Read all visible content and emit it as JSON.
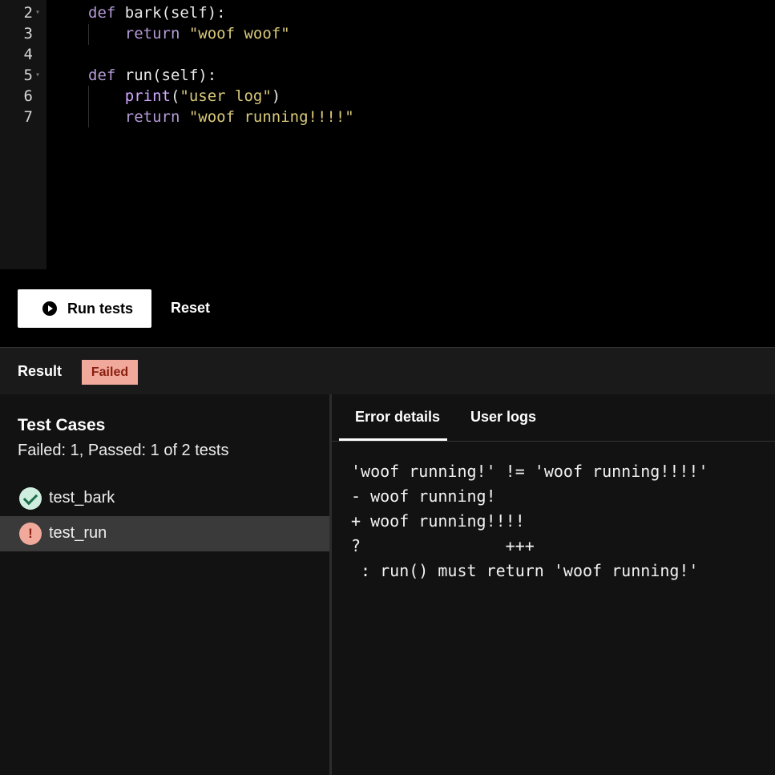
{
  "editor": {
    "lines": [
      {
        "num": "2",
        "fold": true,
        "parts": [
          {
            "t": "def ",
            "c": "kw"
          },
          {
            "t": "bark",
            "c": "plain"
          },
          {
            "t": "(self):",
            "c": "plain"
          }
        ]
      },
      {
        "num": "3",
        "fold": false,
        "parts": [
          {
            "t": "    return ",
            "c": "kw"
          },
          {
            "t": "\"woof woof\"",
            "c": "str"
          }
        ]
      },
      {
        "num": "4",
        "fold": false,
        "parts": []
      },
      {
        "num": "5",
        "fold": true,
        "parts": [
          {
            "t": "def ",
            "c": "kw"
          },
          {
            "t": "run",
            "c": "plain"
          },
          {
            "t": "(self):",
            "c": "plain"
          }
        ]
      },
      {
        "num": "6",
        "fold": false,
        "parts": [
          {
            "t": "    print",
            "c": "fn"
          },
          {
            "t": "(",
            "c": "plain"
          },
          {
            "t": "\"user log\"",
            "c": "str"
          },
          {
            "t": ")",
            "c": "plain"
          }
        ]
      },
      {
        "num": "7",
        "fold": false,
        "parts": [
          {
            "t": "    return ",
            "c": "kw"
          },
          {
            "t": "\"woof running!!!!\"",
            "c": "str"
          }
        ]
      }
    ]
  },
  "toolbar": {
    "run_label": "Run tests",
    "reset_label": "Reset",
    "run_icon": "play-icon"
  },
  "result": {
    "label": "Result",
    "status": "Failed",
    "status_color": "#f0a99a"
  },
  "test_cases": {
    "title": "Test Cases",
    "summary": "Failed: 1, Passed: 1 of 2 tests",
    "items": [
      {
        "name": "test_bark",
        "status": "passed",
        "icon": "check-circle-icon"
      },
      {
        "name": "test_run",
        "status": "failed",
        "icon": "alert-icon",
        "icon_text": "!"
      }
    ]
  },
  "details": {
    "tabs": [
      {
        "label": "Error details",
        "active": true
      },
      {
        "label": "User logs",
        "active": false
      }
    ],
    "error_lines": [
      "'woof running!' != 'woof running!!!!'",
      "- woof running!",
      "+ woof running!!!!",
      "?               +++",
      " : run() must return 'woof running!'"
    ]
  }
}
